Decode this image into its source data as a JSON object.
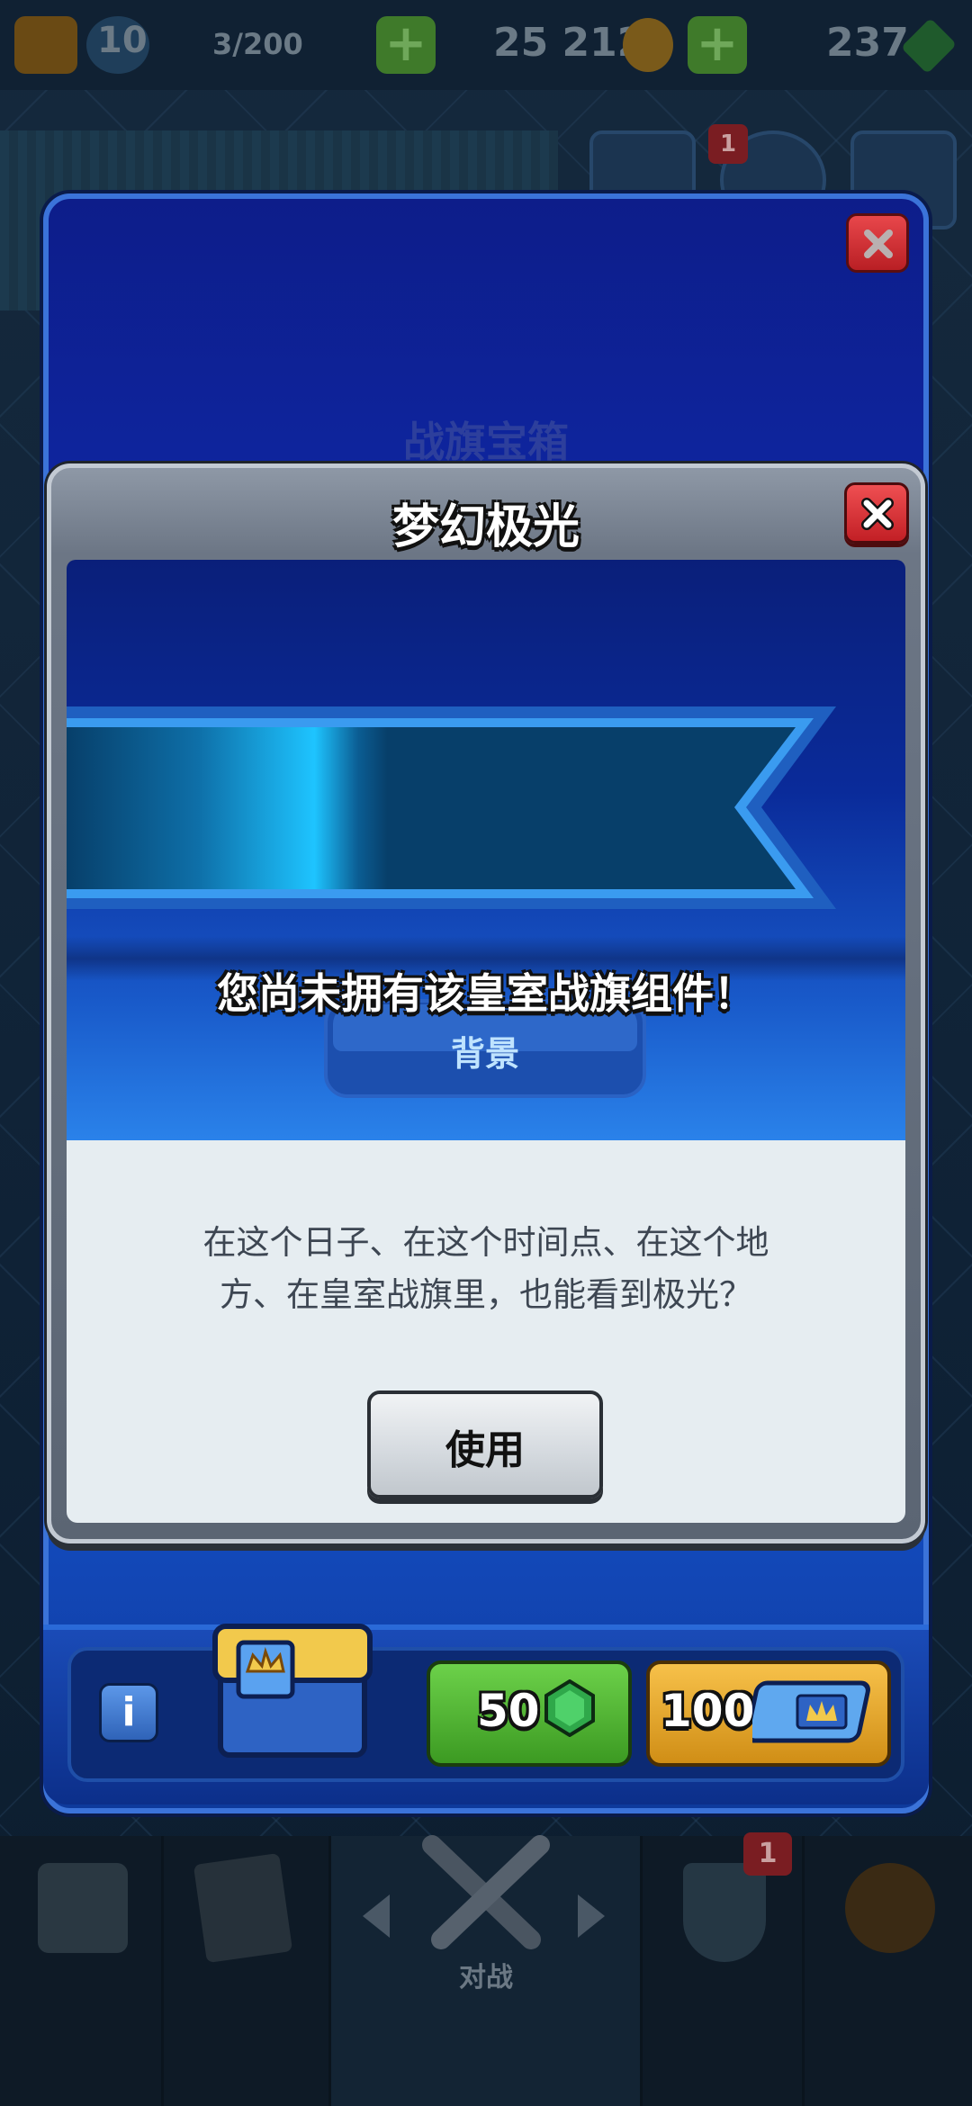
{
  "status_bar": {
    "level": "10",
    "trophies": "3/200",
    "gold": "25 212",
    "gems": "237"
  },
  "chest": {
    "title": "战旗宝箱",
    "gem_price": "50",
    "ticket_price": "100"
  },
  "modal": {
    "title": "梦幻极光",
    "not_owned": "您尚未拥有该皇室战旗组件！",
    "category": "背景",
    "description_line1": "在这个日子、在这个时间点、在这个地",
    "description_line2": "方、在皇室战旗里，也能看到极光？",
    "use_button": "使用"
  },
  "bottom_nav": {
    "battle_label": "对战",
    "clan_badge": "1",
    "friends_badge": "1"
  },
  "colors": {
    "modal_frame": "#6c7685",
    "banner_glow": "#1ec4ff",
    "banner_dark": "#073f6a",
    "banner_border": "#3a9bf0",
    "close_red": "#c21f25",
    "gem_green": "#3c9a22",
    "ticket_gold": "#d08e16"
  }
}
